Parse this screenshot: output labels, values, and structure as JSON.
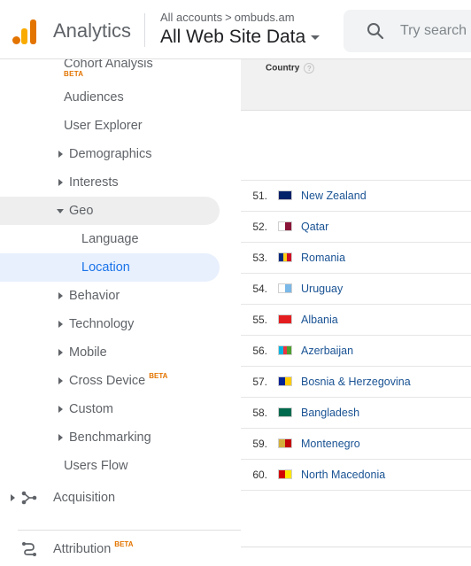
{
  "header": {
    "app_title": "Analytics",
    "breadcrumb": {
      "root": "All accounts",
      "separator": ">",
      "property": "ombuds.am"
    },
    "view_name": "All Web Site Data",
    "search_placeholder": "Try search"
  },
  "sidebar": {
    "cohort": {
      "label": "Cohort Analysis",
      "badge": "BETA"
    },
    "audiences": "Audiences",
    "user_explorer": "User Explorer",
    "demographics": "Demographics",
    "interests": "Interests",
    "geo": "Geo",
    "language": "Language",
    "location": "Location",
    "behavior": "Behavior",
    "technology": "Technology",
    "mobile": "Mobile",
    "cross_device": {
      "label": "Cross Device",
      "badge": "BETA"
    },
    "custom": "Custom",
    "benchmarking": "Benchmarking",
    "users_flow": "Users Flow",
    "acquisition": "Acquisition",
    "attribution": {
      "label": "Attribution",
      "badge": "BETA"
    }
  },
  "table": {
    "column_header": "Country",
    "help_glyph": "?",
    "rows": [
      {
        "num": "51.",
        "country": "New Zealand",
        "flag": [
          "#012169",
          "#012169"
        ]
      },
      {
        "num": "52.",
        "country": "Qatar",
        "flag": [
          "#ffffff",
          "#8a1538"
        ]
      },
      {
        "num": "53.",
        "country": "Romania",
        "flag": [
          "#002b7f",
          "#fcd116",
          "#ce1126"
        ]
      },
      {
        "num": "54.",
        "country": "Uruguay",
        "flag": [
          "#ffffff",
          "#7ab8e8"
        ]
      },
      {
        "num": "55.",
        "country": "Albania",
        "flag": [
          "#e41e20"
        ]
      },
      {
        "num": "56.",
        "country": "Azerbaijan",
        "flag": [
          "#00b5e2",
          "#ef3340",
          "#509e2f"
        ]
      },
      {
        "num": "57.",
        "country": "Bosnia & Herzegovina",
        "flag": [
          "#002395",
          "#fecb00"
        ]
      },
      {
        "num": "58.",
        "country": "Bangladesh",
        "flag": [
          "#006a4e"
        ]
      },
      {
        "num": "59.",
        "country": "Montenegro",
        "flag": [
          "#d3ae3b",
          "#c40308"
        ]
      },
      {
        "num": "60.",
        "country": "North Macedonia",
        "flag": [
          "#d20000",
          "#ffe600"
        ]
      }
    ]
  },
  "colors": {
    "accent_blue": "#1a73e8",
    "link_blue": "#1a5394",
    "beta_orange": "#e37400",
    "active_bg": "#e8f0fe"
  }
}
